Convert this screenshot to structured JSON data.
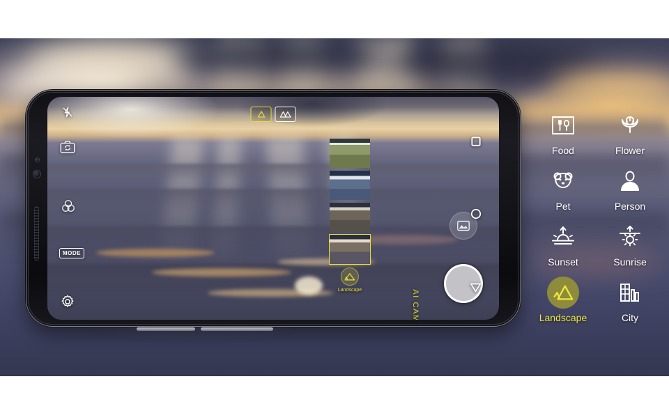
{
  "background": {
    "description": "blurred canyon landscape at sunrise with light rays",
    "top_band_color": "#ffffff",
    "bottom_band_color": "#ffffff"
  },
  "device": {
    "name": "smartphone",
    "orientation": "landscape",
    "frame_color": "#101014",
    "buttons": [
      "volume-up",
      "volume-down"
    ]
  },
  "viewfinder": {
    "lens_toggle": [
      {
        "name": "standard-lens",
        "icon": "single-mountain-icon",
        "active": true
      },
      {
        "name": "wide-angle-lens",
        "icon": "double-mountain-icon",
        "active": false
      }
    ],
    "left_controls": [
      {
        "name": "flash-off",
        "icon": "flash-off-icon",
        "label": ""
      },
      {
        "name": "switch-camera",
        "icon": "camera-switch-icon",
        "label": ""
      },
      {
        "name": "filters",
        "icon": "filters-icon",
        "label": ""
      },
      {
        "name": "mode",
        "icon": "mode-box-icon",
        "label": "MODE"
      },
      {
        "name": "settings",
        "icon": "gear-icon",
        "label": ""
      }
    ],
    "right_controls": [
      {
        "name": "gallery",
        "icon": "gallery-icon"
      },
      {
        "name": "shutter",
        "icon": "shutter-icon"
      },
      {
        "name": "record-video",
        "icon": "record-dot-icon"
      }
    ],
    "nav_bar": [
      {
        "name": "recents",
        "icon": "square-icon"
      },
      {
        "name": "home",
        "icon": "circle-icon"
      },
      {
        "name": "back",
        "icon": "triangle-down-icon"
      }
    ],
    "ai_cam_label": "AI CAM",
    "ai_cam_color": "#e8e032",
    "filmstrip": {
      "count": 4,
      "selected_index": 3,
      "thumbs": [
        "thumb-1",
        "thumb-2",
        "thumb-3",
        "thumb-4"
      ]
    },
    "detected_scene": {
      "label": "Landscape",
      "icon": "mountain-icon",
      "color": "#e8e032"
    }
  },
  "scene_panel": {
    "accent_color": "#f0e83c",
    "active_bg_color": "#8e8c3c",
    "items": [
      {
        "label": "Food",
        "icon": "food-tray-icon",
        "active": false
      },
      {
        "label": "Flower",
        "icon": "flower-icon",
        "active": false
      },
      {
        "label": "Pet",
        "icon": "pet-bear-icon",
        "active": false
      },
      {
        "label": "Person",
        "icon": "person-icon",
        "active": false
      },
      {
        "label": "Sunset",
        "icon": "sunset-icon",
        "active": false
      },
      {
        "label": "Sunrise",
        "icon": "sunrise-icon",
        "active": false
      },
      {
        "label": "Landscape",
        "icon": "mountain-icon",
        "active": true
      },
      {
        "label": "City",
        "icon": "buildings-icon",
        "active": false
      }
    ]
  }
}
